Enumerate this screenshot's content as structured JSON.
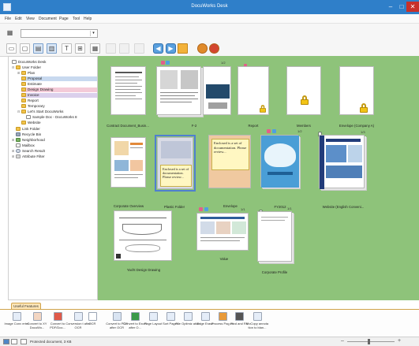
{
  "window": {
    "title": "DocuWorks Desk",
    "minimize": "–",
    "maximize": "□",
    "close": "✕"
  },
  "menu": [
    "File",
    "Edit",
    "View",
    "Document",
    "Page",
    "Tool",
    "Help"
  ],
  "toolbar": {
    "icons": [
      "scanner-icon",
      "copy-icon",
      "paste-icon",
      "merge-icon",
      "split-icon",
      "binoculars-icon",
      "grid-icon",
      "page-prev-icon",
      "page-next-icon",
      "duplicate-icon",
      "print-icon",
      "nav-left-icon",
      "nav-right-icon",
      "send-icon",
      "attach-icon",
      "print-pdf-icon"
    ],
    "dropdown_value": ""
  },
  "tree": {
    "items": [
      {
        "label": "DocuWorks Desk",
        "icon": "desk-icon",
        "depth": 0,
        "state": ""
      },
      {
        "label": "User Folder",
        "icon": "folder-icon",
        "depth": 1,
        "state": ""
      },
      {
        "label": "Plan",
        "icon": "folder-icon",
        "depth": 2,
        "state": ""
      },
      {
        "label": "Proposal",
        "icon": "folder-icon",
        "depth": 2,
        "state": "selected"
      },
      {
        "label": "Estimate",
        "icon": "folder-icon",
        "depth": 2,
        "state": ""
      },
      {
        "label": "Design Drawing",
        "icon": "folder-icon",
        "depth": 2,
        "state": "design"
      },
      {
        "label": "Invoice",
        "icon": "folder-icon",
        "depth": 2,
        "state": "purple"
      },
      {
        "label": "Report",
        "icon": "folder-icon",
        "depth": 2,
        "state": ""
      },
      {
        "label": "Temporary",
        "icon": "folder-icon",
        "depth": 2,
        "state": ""
      },
      {
        "label": "Let's Start DocuWorks",
        "icon": "folder-icon",
        "depth": 2,
        "state": ""
      },
      {
        "label": "Sample Doc - DocuWorks 8",
        "icon": "doc-icon",
        "depth": 3,
        "state": ""
      },
      {
        "label": "Website",
        "icon": "folder-icon",
        "depth": 2,
        "state": ""
      },
      {
        "label": "Link Folder",
        "icon": "folder-icon",
        "depth": 1,
        "state": ""
      },
      {
        "label": "Recycle Bin",
        "icon": "bin-icon",
        "depth": 1,
        "state": ""
      },
      {
        "label": "Neighborhood",
        "icon": "network-icon",
        "depth": 1,
        "state": ""
      },
      {
        "label": "Mailbox",
        "icon": "doc-icon",
        "depth": 1,
        "state": ""
      },
      {
        "label": "Search Result",
        "icon": "search-icon",
        "depth": 1,
        "state": ""
      },
      {
        "label": "Attribute Filter",
        "icon": "filter-icon",
        "depth": 1,
        "state": ""
      }
    ]
  },
  "workspace": {
    "bg_color": "#8ec37a",
    "documents": [
      {
        "label": "Contract Document_Busin...",
        "count": ""
      },
      {
        "label": "F-2",
        "count": "1/2"
      },
      {
        "label": "Report",
        "count": ""
      },
      {
        "label": "Members",
        "count": ""
      },
      {
        "label": "Envelope (Company A)",
        "count": ""
      },
      {
        "label": "Corporate Overview",
        "count": ""
      },
      {
        "label": "Plastic Folder",
        "count": ""
      },
      {
        "label": "Envelope",
        "count": ""
      },
      {
        "label": "FY2012",
        "count": "1/2"
      },
      {
        "label": "Website (English Conveni...",
        "count": "1/3"
      },
      {
        "label": "Yacht Design Drawing",
        "count": ""
      },
      {
        "label": "Value",
        "count": "1/1"
      },
      {
        "label": "Corporate Profile",
        "count": "1/1"
      }
    ],
    "sticky_text": "Enclosed is a set of documentation. Please review..."
  },
  "features": {
    "tab_label": "Useful Features",
    "items": [
      {
        "label": "Image Conv erter",
        "icon": "image-convert-icon"
      },
      {
        "label": "Convert to XY DocuWo...",
        "icon": "convert-xdw-icon"
      },
      {
        "label": "Convert to PDF/Doc...",
        "icon": "convert-pdf-icon"
      },
      {
        "label": "Conversion t after OCR",
        "icon": "ocr-convert-icon"
      },
      {
        "label": "OCR",
        "icon": "ocr-icon"
      },
      {
        "label": "Convert to PDF after OCR",
        "icon": "pdf-ocr-icon"
      },
      {
        "label": "Convert to Excel after O...",
        "icon": "excel-icon"
      },
      {
        "label": "Page Layout",
        "icon": "layout-icon"
      },
      {
        "label": "Sort Pages",
        "icon": "sort-pages-icon"
      },
      {
        "label": "File Optimiz ation",
        "icon": "optimize-icon"
      },
      {
        "label": "Edge Erase",
        "icon": "edge-erase-icon"
      },
      {
        "label": "Process Pag es",
        "icon": "process-pages-icon"
      },
      {
        "label": "Find and Rit",
        "icon": "find-icon"
      },
      {
        "label": "MoCopy annota tion to blan...",
        "icon": "copy-annotation-icon"
      }
    ]
  },
  "status": {
    "text": "Protected document, 3 KB",
    "zoom_minus": "–",
    "zoom_plus": "+",
    "zoom_level": 0.45
  }
}
